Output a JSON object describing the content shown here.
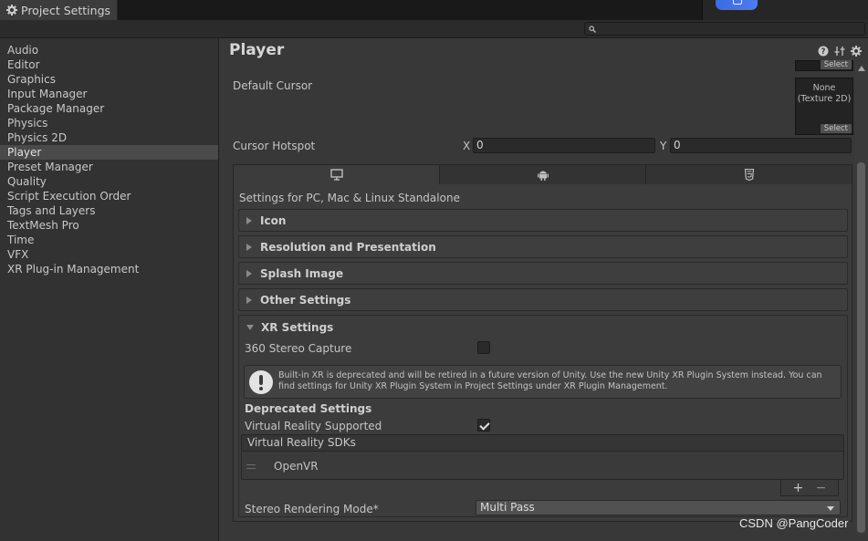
{
  "window": {
    "tab_title": "Project Settings",
    "search_placeholder": ""
  },
  "sidebar": {
    "items": [
      {
        "label": "Audio"
      },
      {
        "label": "Editor"
      },
      {
        "label": "Graphics"
      },
      {
        "label": "Input Manager"
      },
      {
        "label": "Package Manager"
      },
      {
        "label": "Physics"
      },
      {
        "label": "Physics 2D"
      },
      {
        "label": "Player",
        "active": true
      },
      {
        "label": "Preset Manager"
      },
      {
        "label": "Quality"
      },
      {
        "label": "Script Execution Order"
      },
      {
        "label": "Tags and Layers"
      },
      {
        "label": "TextMesh Pro"
      },
      {
        "label": "Time"
      },
      {
        "label": "VFX"
      },
      {
        "label": "XR Plug-in Management"
      }
    ]
  },
  "main": {
    "title": "Player",
    "icon_names": [
      "help-icon",
      "preset-icon",
      "gear-icon"
    ],
    "texture_top": {
      "select_label": "Select"
    },
    "default_cursor": {
      "label": "Default Cursor",
      "texture_text_line1": "None",
      "texture_text_line2": "(Texture 2D)",
      "select_label": "Select"
    },
    "cursor_hotspot": {
      "label": "Cursor Hotspot",
      "x_label": "X",
      "x_value": "0",
      "y_label": "Y",
      "y_value": "0"
    },
    "platform_tabs": [
      {
        "icon": "monitor-icon",
        "active": true
      },
      {
        "icon": "android-icon",
        "active": false
      },
      {
        "icon": "html5-icon",
        "active": false
      }
    ],
    "settings_for": "Settings for PC, Mac & Linux Standalone",
    "foldouts": [
      {
        "title": "Icon"
      },
      {
        "title": "Resolution and Presentation"
      },
      {
        "title": "Splash Image"
      },
      {
        "title": "Other Settings"
      }
    ],
    "xr": {
      "title": "XR Settings",
      "stereo_capture_label": "360 Stereo Capture",
      "stereo_capture_checked": false,
      "help_text": "Built-in XR is deprecated and will be retired in a future version of Unity. Use the new Unity XR Plugin System instead. You can find settings for Unity XR Plugin System in Project Settings under XR Plugin Management.",
      "deprecated_heading": "Deprecated Settings",
      "vr_supported_label": "Virtual Reality Supported",
      "vr_supported_checked": true,
      "sdk_header": "Virtual Reality SDKs",
      "sdk_items": [
        "OpenVR"
      ],
      "add_label": "+",
      "remove_label": "−",
      "stereo_mode_label": "Stereo Rendering Mode*",
      "stereo_mode_value": "Multi Pass"
    }
  },
  "watermark": "CSDN @PangCoder",
  "colors": {
    "background": "#383838",
    "sidebar": "#323232",
    "selected": "#4a4a4a",
    "accent_blue": "#3a6be0"
  }
}
